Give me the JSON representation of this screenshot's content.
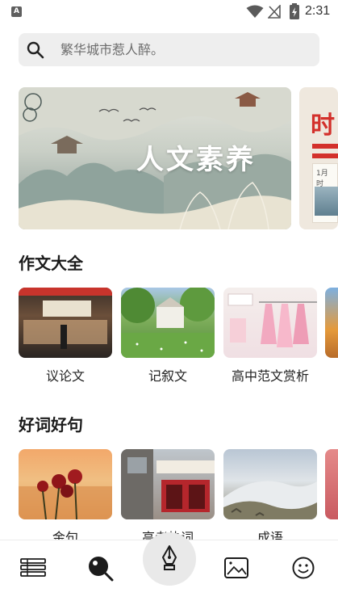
{
  "status_bar": {
    "app_icon_letter": "A",
    "time": "2:31"
  },
  "search": {
    "placeholder": "繁华城市惹人醉。"
  },
  "banners": [
    {
      "title": "人文素养"
    },
    {
      "title": "时",
      "small_text": "1月  时"
    }
  ],
  "sections": [
    {
      "title": "作文大全",
      "items": [
        {
          "label": "议论文"
        },
        {
          "label": "记叙文"
        },
        {
          "label": "高中范文赏析"
        }
      ]
    },
    {
      "title": "好词好句",
      "items": [
        {
          "label": "金句"
        },
        {
          "label": "高考热词"
        },
        {
          "label": "成语"
        }
      ]
    }
  ],
  "bottom_nav": {
    "items": [
      {
        "icon": "list-icon"
      },
      {
        "icon": "search-lens-icon"
      },
      {
        "icon": "pen-nib-icon"
      },
      {
        "icon": "gallery-icon"
      },
      {
        "icon": "smiley-icon"
      }
    ]
  },
  "colors": {
    "accent_red": "#d3302b",
    "search_bg": "#eeeeee",
    "nav_center_bg": "#e9e9e9"
  }
}
